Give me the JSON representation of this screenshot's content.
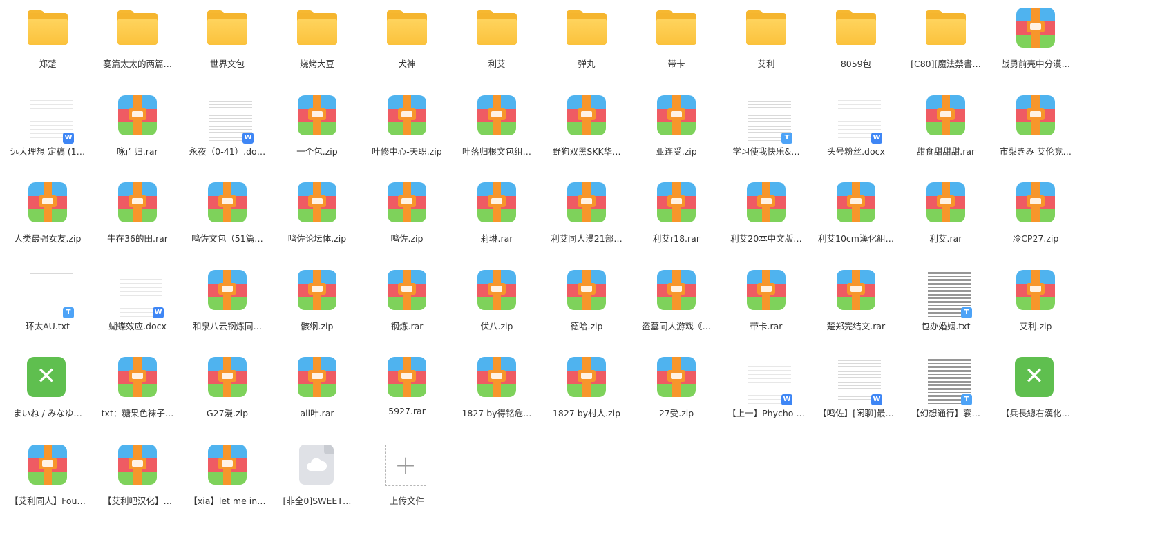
{
  "files": [
    {
      "label": "郑楚",
      "type": "folder"
    },
    {
      "label": "宴篇太太的两篇…",
      "type": "folder"
    },
    {
      "label": "世界文包",
      "type": "folder"
    },
    {
      "label": "烧烤大豆",
      "type": "folder"
    },
    {
      "label": "犬神",
      "type": "folder"
    },
    {
      "label": "利艾",
      "type": "folder"
    },
    {
      "label": "弹丸",
      "type": "folder"
    },
    {
      "label": "带卡",
      "type": "folder"
    },
    {
      "label": "艾利",
      "type": "folder"
    },
    {
      "label": "8059包",
      "type": "folder"
    },
    {
      "label": "[C80][魔法禁書…",
      "type": "folder"
    },
    {
      "label": "战勇前壳中分漠…",
      "type": "archive"
    },
    {
      "label": "远大理想 定稿 (1…",
      "type": "doc",
      "badge": "W",
      "density": "sparse"
    },
    {
      "label": "咏而归.rar",
      "type": "archive"
    },
    {
      "label": "永夜（0-41）.do…",
      "type": "doc",
      "badge": "W",
      "density": "normal"
    },
    {
      "label": "一个包.zip",
      "type": "archive"
    },
    {
      "label": "叶修中心-天职.zip",
      "type": "archive"
    },
    {
      "label": "叶落归根文包组…",
      "type": "archive"
    },
    {
      "label": "野狗双黑SKK华…",
      "type": "archive"
    },
    {
      "label": "亚连受.zip",
      "type": "archive"
    },
    {
      "label": "学习使我快乐&…",
      "type": "doc",
      "badge": "T",
      "density": "normal"
    },
    {
      "label": "头号粉丝.docx",
      "type": "doc",
      "badge": "W",
      "density": "sparse"
    },
    {
      "label": "甜食甜甜甜.rar",
      "type": "archive"
    },
    {
      "label": "市梨きみ 艾伦竞…",
      "type": "archive"
    },
    {
      "label": "人类最强女友.zip",
      "type": "archive"
    },
    {
      "label": "牛在36的田.rar",
      "type": "archive"
    },
    {
      "label": "鸣佐文包（51篇…",
      "type": "archive"
    },
    {
      "label": "鸣佐论坛体.zip",
      "type": "archive"
    },
    {
      "label": "鸣佐.zip",
      "type": "archive"
    },
    {
      "label": "莉琳.rar",
      "type": "archive"
    },
    {
      "label": "利艾同人漫21部…",
      "type": "archive"
    },
    {
      "label": "利艾r18.rar",
      "type": "archive"
    },
    {
      "label": "利艾20本中文版…",
      "type": "archive"
    },
    {
      "label": "利艾10cm漢化組…",
      "type": "archive"
    },
    {
      "label": "利艾.rar",
      "type": "archive"
    },
    {
      "label": "冷CP27.zip",
      "type": "archive"
    },
    {
      "label": "环太AU.txt",
      "type": "doc",
      "badge": "T",
      "density": "top"
    },
    {
      "label": "蝴蝶效应.docx",
      "type": "doc",
      "badge": "W",
      "density": "sparse"
    },
    {
      "label": "和泉八云钢炼同…",
      "type": "archive"
    },
    {
      "label": "骸纲.zip",
      "type": "archive"
    },
    {
      "label": "钢炼.rar",
      "type": "archive"
    },
    {
      "label": "伏八.zip",
      "type": "archive"
    },
    {
      "label": "德哈.zip",
      "type": "archive"
    },
    {
      "label": "盗墓同人游戏《…",
      "type": "archive"
    },
    {
      "label": "带卡.rar",
      "type": "archive"
    },
    {
      "label": "楚郑完结文.rar",
      "type": "archive"
    },
    {
      "label": "包办婚姻.txt",
      "type": "doc",
      "badge": "T",
      "density": "dense"
    },
    {
      "label": "艾利.zip",
      "type": "archive"
    },
    {
      "label": "まいね / みなゆ…",
      "type": "excel"
    },
    {
      "label": "txt：糖果色袜子…",
      "type": "archive"
    },
    {
      "label": "G27漫.zip",
      "type": "archive"
    },
    {
      "label": "all叶.rar",
      "type": "archive"
    },
    {
      "label": "5927.rar",
      "type": "archive"
    },
    {
      "label": "1827 by得铭危…",
      "type": "archive"
    },
    {
      "label": "1827 by村人.zip",
      "type": "archive"
    },
    {
      "label": "27受.zip",
      "type": "archive"
    },
    {
      "label": "【上一】Phycho …",
      "type": "doc",
      "badge": "W",
      "density": "sparse"
    },
    {
      "label": "【鸣佐】[闲聊]最…",
      "type": "doc",
      "badge": "W",
      "density": "normal"
    },
    {
      "label": "【幻想通行】衮…",
      "type": "doc",
      "badge": "T",
      "density": "dense"
    },
    {
      "label": "【兵長總右漢化…",
      "type": "excel"
    },
    {
      "label": "【艾利同人】Fou…",
      "type": "archive"
    },
    {
      "label": "【艾利吧汉化】…",
      "type": "archive"
    },
    {
      "label": "【xia】let me in…",
      "type": "archive"
    },
    {
      "label": "[非全0]SWEET…",
      "type": "cloud"
    },
    {
      "label": "上传文件",
      "type": "upload",
      "glyph": "+"
    }
  ],
  "icons": {
    "folder": "folder-icon",
    "archive": "archive-icon",
    "doc": "document-thumbnail-icon",
    "excel": "excel-icon",
    "cloud": "cloud-file-icon",
    "upload": "upload-plus-icon"
  }
}
